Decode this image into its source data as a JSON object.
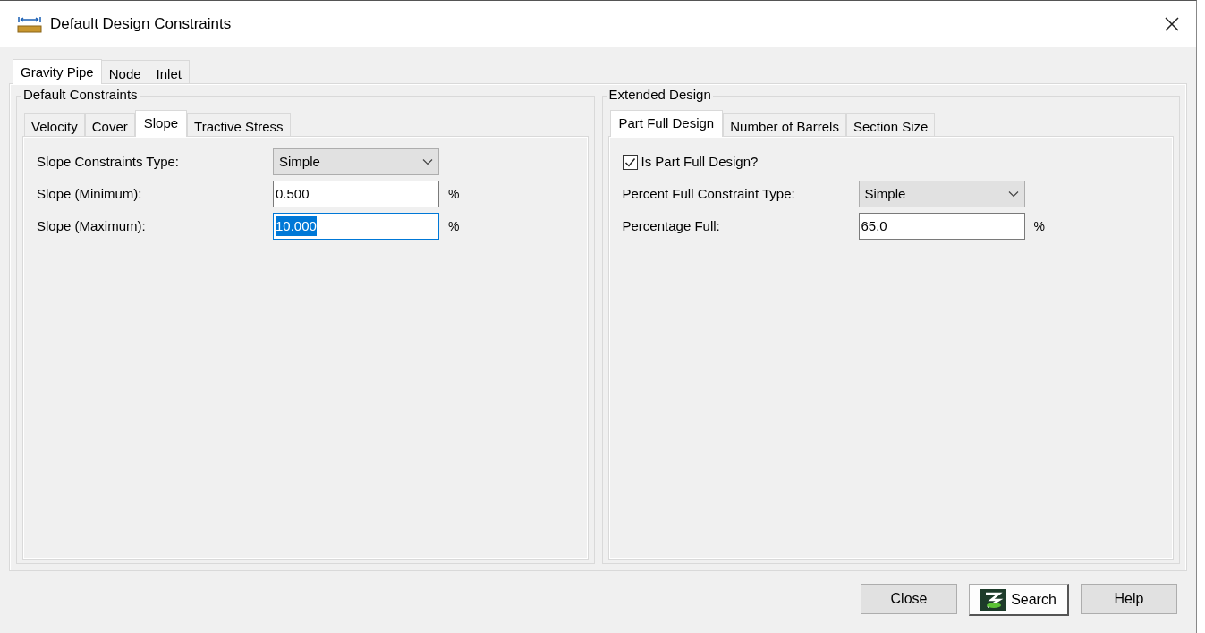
{
  "window": {
    "title": "Default Design Constraints"
  },
  "tabs": [
    {
      "label": "Gravity Pipe",
      "selected": true
    },
    {
      "label": "Node",
      "selected": false
    },
    {
      "label": "Inlet",
      "selected": false
    }
  ],
  "groups": [
    {
      "title": "Default Constraints",
      "tabs": [
        {
          "label": "Velocity",
          "selected": false
        },
        {
          "label": "Cover",
          "selected": false
        },
        {
          "label": "Slope",
          "selected": true
        },
        {
          "label": "Tractive Stress",
          "selected": false
        }
      ],
      "rows": [
        {
          "kind": "dropdown",
          "label": "Slope Constraints Type:",
          "value": "Simple"
        },
        {
          "kind": "text",
          "label": "Slope (Minimum):",
          "value": "0.500",
          "unit": "%",
          "focused": false
        },
        {
          "kind": "text",
          "label": "Slope (Maximum):",
          "value": "10.000",
          "unit": "%",
          "focused": true
        }
      ]
    },
    {
      "title": "Extended Design",
      "tabs": [
        {
          "label": "Part Full Design",
          "selected": true
        },
        {
          "label": "Number of Barrels",
          "selected": false
        },
        {
          "label": "Section Size",
          "selected": false
        }
      ],
      "rows": [
        {
          "kind": "checkbox",
          "label": "Is Part Full Design?",
          "checked": true
        },
        {
          "kind": "dropdown",
          "label": "Percent Full Constraint Type:",
          "value": "Simple"
        },
        {
          "kind": "text",
          "label": "Percentage Full:",
          "value": "65.0",
          "unit": "%",
          "focused": false
        }
      ]
    }
  ],
  "buttons": [
    {
      "label": "Close",
      "kind": "plain"
    },
    {
      "label": "Search",
      "kind": "logo"
    },
    {
      "label": "Help",
      "kind": "plain"
    }
  ]
}
